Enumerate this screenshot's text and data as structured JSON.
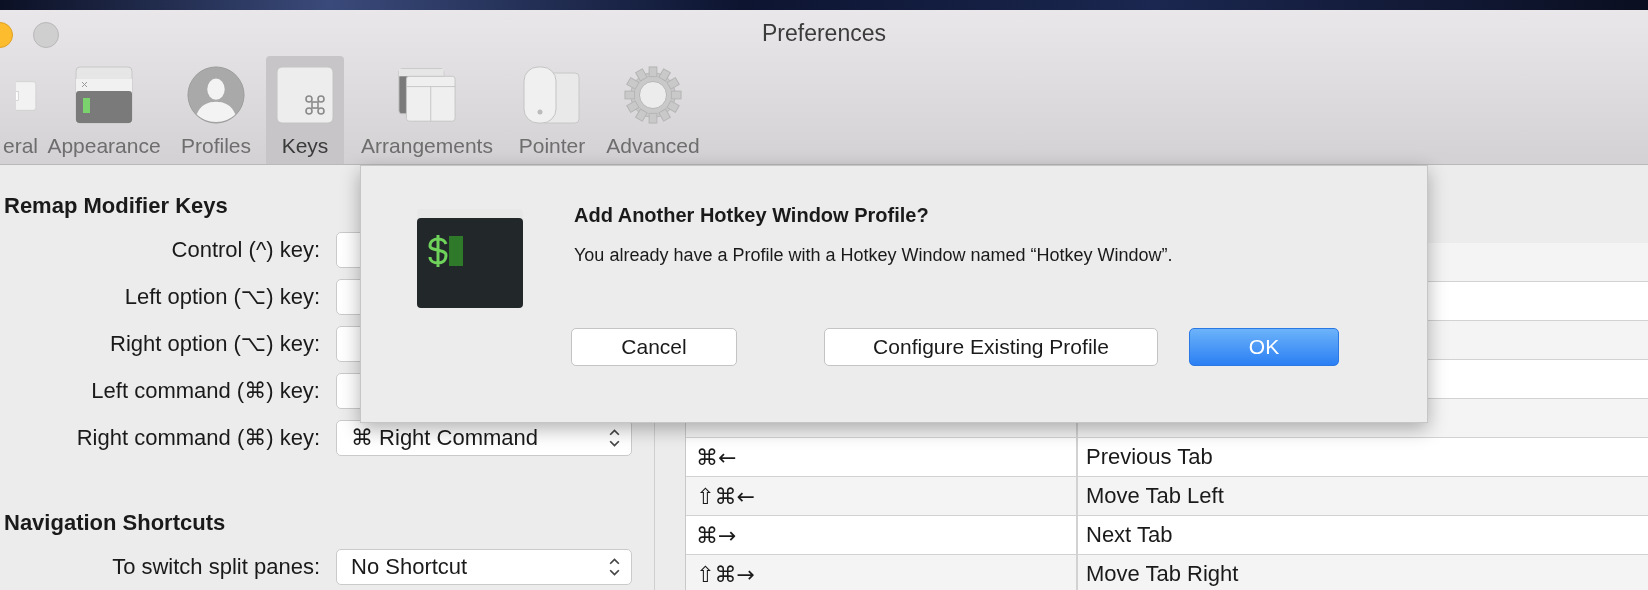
{
  "window": {
    "title": "Preferences"
  },
  "tabs": [
    {
      "label": "eral",
      "kind": "general",
      "selected": false
    },
    {
      "label": "Appearance",
      "kind": "appearance",
      "selected": false
    },
    {
      "label": "Profiles",
      "kind": "profiles",
      "selected": false
    },
    {
      "label": "Keys",
      "kind": "keys",
      "selected": true
    },
    {
      "label": "Arrangements",
      "kind": "arrangements",
      "selected": false
    },
    {
      "label": "Pointer",
      "kind": "pointer",
      "selected": false
    },
    {
      "label": "Advanced",
      "kind": "advanced",
      "selected": false
    }
  ],
  "sections": [
    {
      "title": "Remap Modifier Keys",
      "rows": [
        {
          "label": "Control (^) key:"
        },
        {
          "label": "Left option (⌥) key:"
        },
        {
          "label": "Right option (⌥) key:"
        },
        {
          "label": "Left command (⌘) key:"
        },
        {
          "label": "Right command (⌘) key:",
          "value": "⌘ Right Command"
        }
      ]
    },
    {
      "title": "Navigation Shortcuts",
      "rows": [
        {
          "label": "To switch split panes:",
          "value": "No Shortcut"
        }
      ]
    }
  ],
  "table": {
    "rows": [
      {
        "shortcut": "⌘←",
        "action": "Previous Tab"
      },
      {
        "shortcut": "⇧⌘←",
        "action": "Move Tab Left"
      },
      {
        "shortcut": "⌘→",
        "action": "Next Tab"
      },
      {
        "shortcut": "⇧⌘→",
        "action": "Move Tab Right"
      }
    ]
  },
  "dialog": {
    "title": "Add Another Hotkey Window Profile?",
    "message": "You already have a Profile with a Hotkey Window named “Hotkey Window”.",
    "buttons": [
      {
        "label": "Cancel",
        "default": false
      },
      {
        "label": "Configure Existing Profile",
        "default": false
      },
      {
        "label": "OK",
        "default": true
      }
    ]
  }
}
